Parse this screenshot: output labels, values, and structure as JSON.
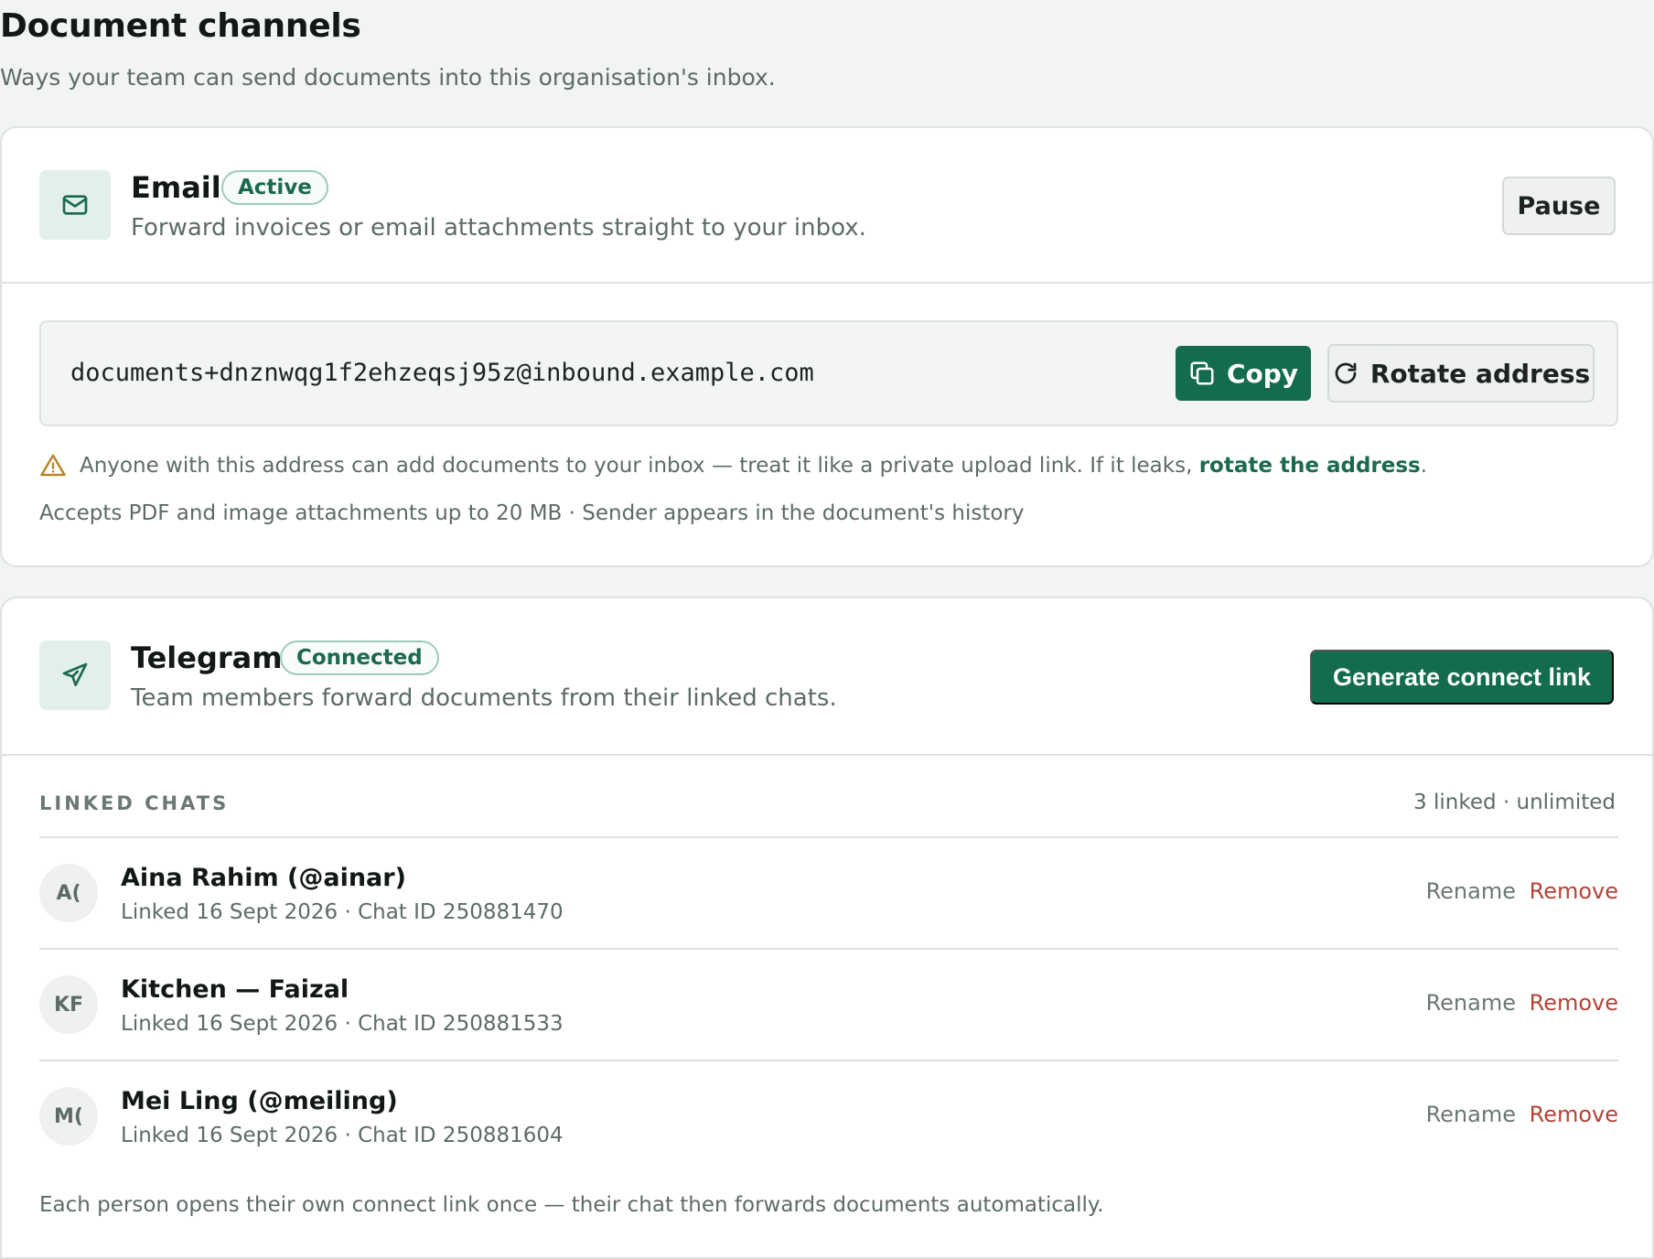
{
  "page": {
    "title": "Document channels",
    "subtitle": "Ways your team can send documents into this organisation's inbox."
  },
  "email": {
    "icon": "mail-icon",
    "name": "Email",
    "status": "Active",
    "description": "Forward invoices or email attachments straight to your inbox.",
    "pause_label": "Pause",
    "address": "documents+dnznwqg1f2ehzeqsj95z@inbound.example.com",
    "copy_label": "Copy",
    "rotate_label": "Rotate address",
    "warning_text": "Anyone with this address can add documents to your inbox — treat it like a private upload link. If it leaks, ",
    "warning_link": "rotate the address",
    "warning_end": ".",
    "accepts_text": "Accepts PDF and image attachments up to 20 MB · Sender appears in the document's history"
  },
  "telegram": {
    "icon": "send-icon",
    "name": "Telegram",
    "status": "Connected",
    "description": "Team members forward documents from their linked chats.",
    "generate_label": "Generate connect link",
    "linked_title": "LINKED CHATS",
    "linked_count": "3 linked · unlimited",
    "chats": [
      {
        "initials": "A(",
        "name": "Aina Rahim (@ainar)",
        "meta": "Linked 16 Sept 2026 · Chat ID 250881470",
        "rename": "Rename",
        "remove": "Remove"
      },
      {
        "initials": "KF",
        "name": "Kitchen — Faizal",
        "meta": "Linked 16 Sept 2026 · Chat ID 250881533",
        "rename": "Rename",
        "remove": "Remove"
      },
      {
        "initials": "M(",
        "name": "Mei Ling (@meiling)",
        "meta": "Linked 16 Sept 2026 · Chat ID 250881604",
        "rename": "Rename",
        "remove": "Remove"
      }
    ],
    "footnote": "Each person opens their own connect link once — their chat then forwards documents automatically."
  },
  "colors": {
    "accent": "#136b50",
    "danger": "#b3443a",
    "warning": "#b8862a"
  }
}
